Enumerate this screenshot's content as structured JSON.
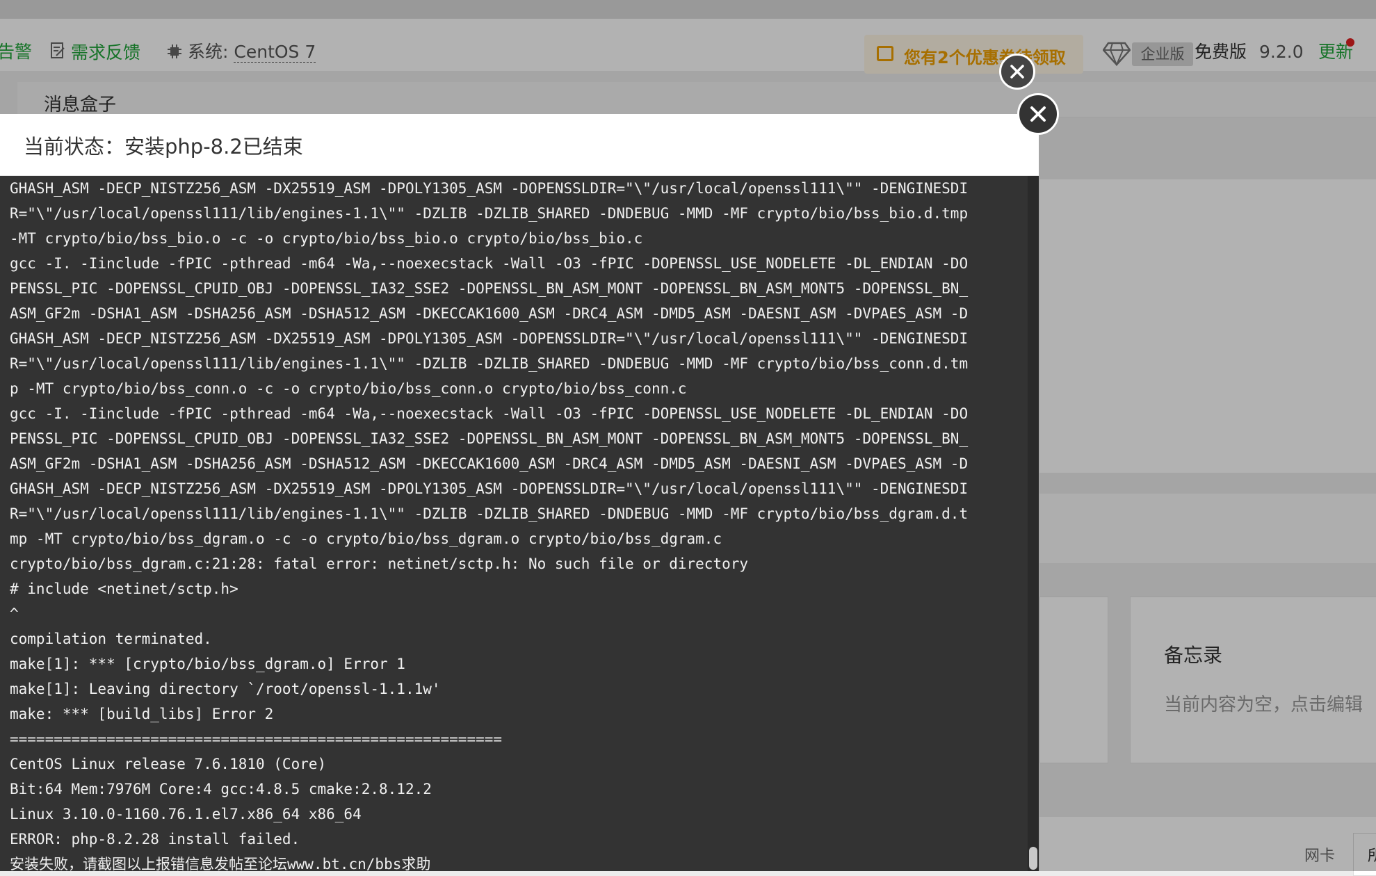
{
  "topbar": {
    "alert_partial": "告警",
    "feedback_label": "需求反馈",
    "system_label": "系统:",
    "system_value": "CentOS 7",
    "promo_text": "您有2个优惠券待领取",
    "edition_badge": "企业版",
    "edition_free": "免费版",
    "version": "9.2.0",
    "update_label": "更新"
  },
  "message_box": {
    "title": "消息盒子"
  },
  "memo_card": {
    "title": "备忘录",
    "empty_text": "当前内容为空，点击编辑"
  },
  "bottom": {
    "nic_label": "网卡",
    "partial_char": "所"
  },
  "modal": {
    "title": "当前状态：安装php-8.2已结束",
    "log_lines": [
      "GHASH_ASM -DECP_NISTZ256_ASM -DX25519_ASM -DPOLY1305_ASM -DOPENSSLDIR=\"\\\"/usr/local/openssl111\\\"\" -DENGINESDI",
      "R=\"\\\"/usr/local/openssl111/lib/engines-1.1\\\"\" -DZLIB -DZLIB_SHARED -DNDEBUG -MMD -MF crypto/bio/bss_bio.d.tmp",
      "-MT crypto/bio/bss_bio.o -c -o crypto/bio/bss_bio.o crypto/bio/bss_bio.c",
      "gcc -I. -Iinclude -fPIC -pthread -m64 -Wa,--noexecstack -Wall -O3 -fPIC -DOPENSSL_USE_NODELETE -DL_ENDIAN -DO",
      "PENSSL_PIC -DOPENSSL_CPUID_OBJ -DOPENSSL_IA32_SSE2 -DOPENSSL_BN_ASM_MONT -DOPENSSL_BN_ASM_MONT5 -DOPENSSL_BN_",
      "ASM_GF2m -DSHA1_ASM -DSHA256_ASM -DSHA512_ASM -DKECCAK1600_ASM -DRC4_ASM -DMD5_ASM -DAESNI_ASM -DVPAES_ASM -D",
      "GHASH_ASM -DECP_NISTZ256_ASM -DX25519_ASM -DPOLY1305_ASM -DOPENSSLDIR=\"\\\"/usr/local/openssl111\\\"\" -DENGINESDI",
      "R=\"\\\"/usr/local/openssl111/lib/engines-1.1\\\"\" -DZLIB -DZLIB_SHARED -DNDEBUG -MMD -MF crypto/bio/bss_conn.d.tm",
      "p -MT crypto/bio/bss_conn.o -c -o crypto/bio/bss_conn.o crypto/bio/bss_conn.c",
      "gcc -I. -Iinclude -fPIC -pthread -m64 -Wa,--noexecstack -Wall -O3 -fPIC -DOPENSSL_USE_NODELETE -DL_ENDIAN -DO",
      "PENSSL_PIC -DOPENSSL_CPUID_OBJ -DOPENSSL_IA32_SSE2 -DOPENSSL_BN_ASM_MONT -DOPENSSL_BN_ASM_MONT5 -DOPENSSL_BN_",
      "ASM_GF2m -DSHA1_ASM -DSHA256_ASM -DSHA512_ASM -DKECCAK1600_ASM -DRC4_ASM -DMD5_ASM -DAESNI_ASM -DVPAES_ASM -D",
      "GHASH_ASM -DECP_NISTZ256_ASM -DX25519_ASM -DPOLY1305_ASM -DOPENSSLDIR=\"\\\"/usr/local/openssl111\\\"\" -DENGINESDI",
      "R=\"\\\"/usr/local/openssl111/lib/engines-1.1\\\"\" -DZLIB -DZLIB_SHARED -DNDEBUG -MMD -MF crypto/bio/bss_dgram.d.t",
      "mp -MT crypto/bio/bss_dgram.o -c -o crypto/bio/bss_dgram.o crypto/bio/bss_dgram.c",
      "crypto/bio/bss_dgram.c:21:28: fatal error: netinet/sctp.h: No such file or directory",
      "# include <netinet/sctp.h>",
      "^",
      "compilation terminated.",
      "make[1]: *** [crypto/bio/bss_dgram.o] Error 1",
      "make[1]: Leaving directory `/root/openssl-1.1.1w'",
      "make: *** [build_libs] Error 2",
      "========================================================",
      "CentOS Linux release 7.6.1810 (Core)",
      "Bit:64 Mem:7976M Core:4 gcc:4.8.5 cmake:2.8.12.2",
      "Linux 3.10.0-1160.76.1.el7.x86_64 x86_64",
      "ERROR: php-8.2.28 install failed.",
      "安装失败，请截图以上报错信息发帖至论坛www.bt.cn/bbs求助"
    ]
  },
  "icons": {
    "feedback": "edit-note-icon",
    "system": "chip-icon",
    "promo": "coupon-icon",
    "edition": "diamond-icon",
    "close": "close-icon"
  },
  "colors": {
    "brand_green": "#20a53a",
    "promo_orange": "#f0a000",
    "terminal_bg": "#333333",
    "terminal_text": "#f0f0f0"
  }
}
